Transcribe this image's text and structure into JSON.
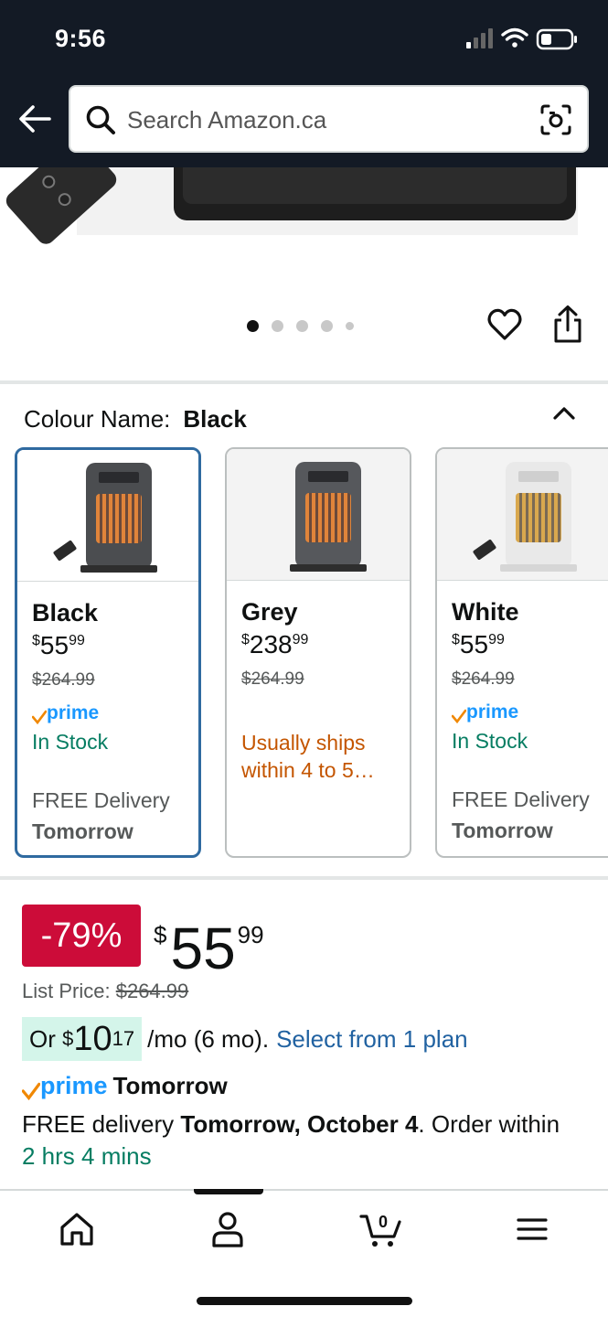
{
  "status_bar": {
    "time": "9:56"
  },
  "search": {
    "placeholder": "Search Amazon.ca"
  },
  "gallery": {
    "dot_count": 5,
    "active_dot": 0
  },
  "colour": {
    "label": "Colour Name:",
    "selected": "Black"
  },
  "variants": [
    {
      "name": "Black",
      "price_whole": "55",
      "price_cents": "99",
      "currency": "$",
      "list_price": "$264.99",
      "prime": true,
      "stock": "In Stock",
      "delivery_line1": "FREE Delivery",
      "delivery_line2": "Tomorrow"
    },
    {
      "name": "Grey",
      "price_whole": "238",
      "price_cents": "99",
      "currency": "$",
      "list_price": "$264.99",
      "prime": false,
      "shipping": "Usually ships within 4 to 5…"
    },
    {
      "name": "White",
      "price_whole": "55",
      "price_cents": "99",
      "currency": "$",
      "list_price": "$264.99",
      "prime": true,
      "stock": "In Stock",
      "delivery_line1": "FREE Delivery",
      "delivery_line2": "Tomorrow"
    }
  ],
  "pricing": {
    "discount": "-79%",
    "currency": "$",
    "price_whole": "55",
    "price_cents": "99",
    "list_label": "List Price:",
    "list_price": "$264.99",
    "installment_prefix": "Or",
    "installment_currency": "$",
    "installment_whole": "10",
    "installment_cents": "17",
    "installment_suffix": "/mo (6 mo).",
    "installment_link": "Select from 1 plan"
  },
  "delivery": {
    "prime_text": "prime",
    "prime_day": "Tomorrow",
    "line_prefix": "FREE delivery",
    "date": "Tomorrow, October 4",
    "order_text": ". Order within",
    "countdown": "2 hrs 4 mins"
  },
  "bottom_nav": {
    "cart_count": "0"
  },
  "colors": {
    "topbar": "#131a25",
    "prime_blue": "#1a98ff",
    "discount_red": "#cc0c39",
    "link_blue": "#2162a1",
    "stock_green": "#067d62",
    "ship_orange": "#c45500",
    "selected_border": "#2f6aa0"
  }
}
